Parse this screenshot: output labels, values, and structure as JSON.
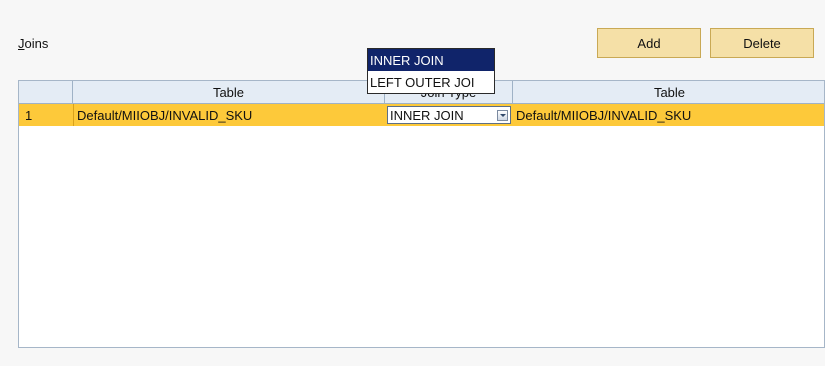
{
  "panel": {
    "title": "Joins",
    "title_mnemonic": "J",
    "title_rest": "oins"
  },
  "toolbar": {
    "add_label": "Add",
    "delete_label": "Delete"
  },
  "grid": {
    "headers": [
      "Table",
      "Join Type",
      "Table"
    ],
    "rows": [
      {
        "row_number": "1",
        "table_left": "Default/MIIOBJ/INVALID_SKU",
        "join_type": "INNER JOIN",
        "table_right": "Default/MIIOBJ/INVALID_SKU"
      }
    ]
  },
  "join_type_dropdown": {
    "options": [
      "INNER JOIN",
      "LEFT OUTER JOI"
    ],
    "selected": "INNER JOIN"
  },
  "colors": {
    "selected_row": "#fdc93a",
    "button_bg": "#f5e0a7",
    "dropdown_highlight": "#10246a",
    "header_bg": "#e4ecf5"
  }
}
